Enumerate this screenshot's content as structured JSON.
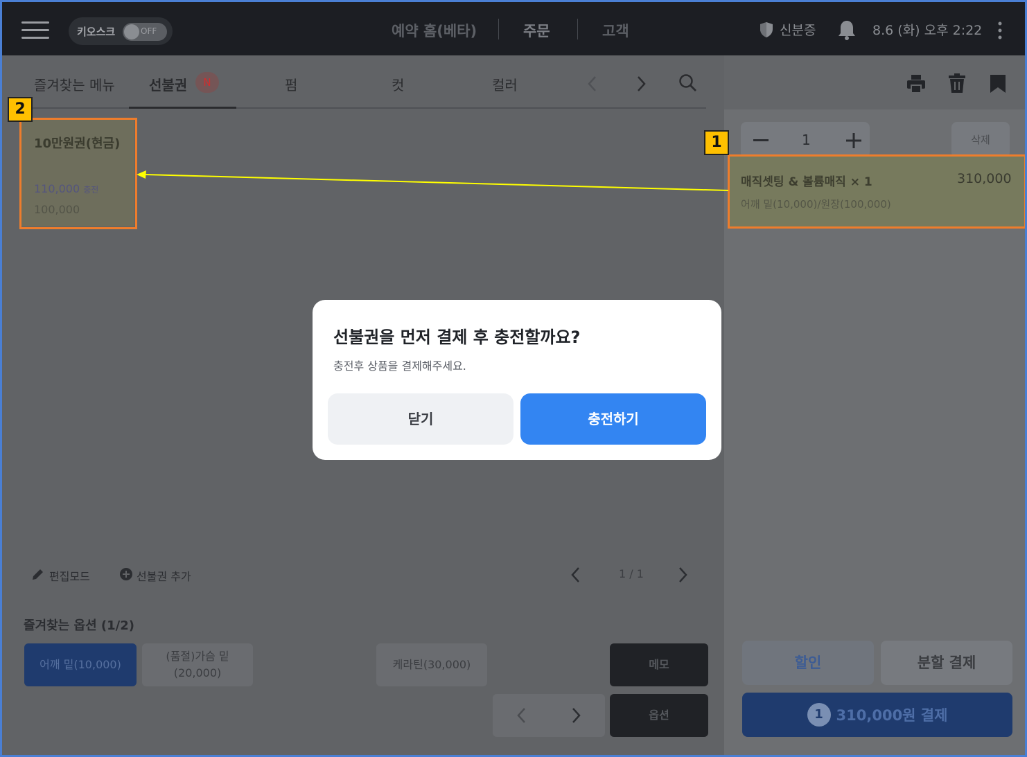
{
  "topbar": {
    "kiosk_label": "키오스크",
    "kiosk_toggle": "OFF",
    "nav": [
      "예약 홈(베타)",
      "주문",
      "고객"
    ],
    "id_label": "신분증",
    "datetime": "8.6 (화) 오후 2:22"
  },
  "tabs": {
    "items": [
      "즐겨찾는 메뉴",
      "선불권",
      "펌",
      "컷",
      "컬러"
    ],
    "badge": "N"
  },
  "product_card": {
    "title": "10만원권(현금)",
    "charge_amount": "110,000",
    "charge_suffix": "충전",
    "price": "100,000"
  },
  "bottom_controls": {
    "edit_mode": "편집모드",
    "add_prepaid": "선불권 추가",
    "page": "1 / 1"
  },
  "favorite_options": {
    "title": "즐겨찾는 옵션 (1/2)",
    "items": [
      "어깨 밑(10,000)",
      "(품절)가슴 밑",
      "(20,000)",
      "케라틴(30,000)"
    ],
    "memo": "메모",
    "option": "옵션"
  },
  "order": {
    "qty": "1",
    "delete": "삭제",
    "item_name": "매직셋팅 & 볼륨매직 × 1",
    "item_price": "310,000",
    "item_sub": "어깨 밑(10,000)/원장(100,000)",
    "discount": "할인",
    "split_pay": "분할 결제",
    "pay_count": "1",
    "pay_label": "310,000원 결제"
  },
  "modal": {
    "title": "선불권을 먼저 결제 후 충전할까요?",
    "subtitle": "충전후 상품을 결제해주세요.",
    "close": "닫기",
    "charge": "충전하기"
  },
  "annotations": {
    "one": "1",
    "two": "2"
  },
  "colors": {
    "primary": "#3385f2",
    "highlight": "#ee7d2c",
    "label": "#ffc000",
    "arrow": "#ffff00"
  }
}
